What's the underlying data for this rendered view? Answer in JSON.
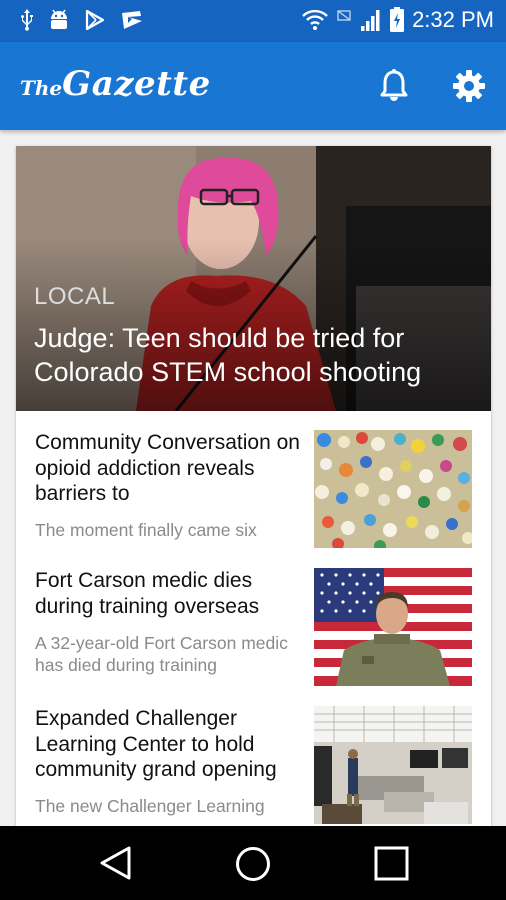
{
  "status_bar": {
    "time": "2:32 PM",
    "icons": [
      "usb-icon",
      "android-icon",
      "play-store-icon",
      "play-movies-icon",
      "wifi-icon",
      "no-sim-icon",
      "signal-icon",
      "battery-charging-icon"
    ]
  },
  "app_bar": {
    "logo_the": "The",
    "logo_name": "Gazette",
    "icons": [
      "bell-icon",
      "gear-icon"
    ]
  },
  "hero": {
    "section": "LOCAL",
    "title": "Judge: Teen should be tried for Colorado STEM school shooting"
  },
  "stories": [
    {
      "title": "Community Conversation on opioid addiction reveals barriers to",
      "summary": "The moment finally came six"
    },
    {
      "title": "Fort Carson medic dies during training overseas",
      "summary": "A 32-year-old Fort Carson medic has died during training"
    },
    {
      "title": "Expanded Challenger Learning Center to hold community grand opening",
      "summary": "The new Challenger Learning"
    }
  ],
  "nav_bar": {
    "icons": [
      "back-icon",
      "home-icon",
      "recents-icon"
    ]
  }
}
